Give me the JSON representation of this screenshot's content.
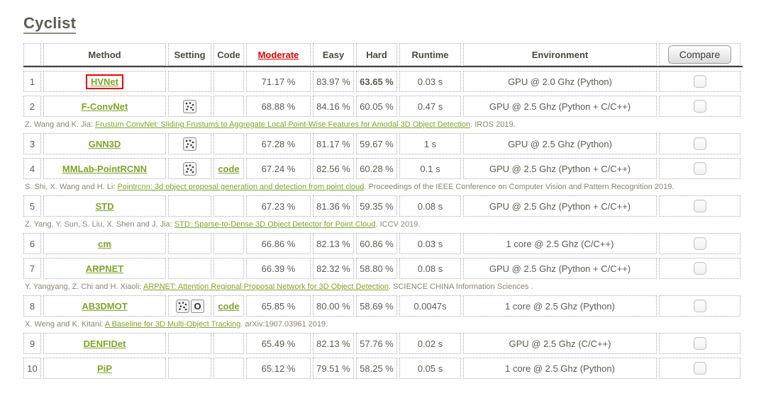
{
  "page": {
    "title": "Cyclist"
  },
  "colors": {
    "link_green": "#82a32d",
    "moderate_red": "#e10000",
    "highlight_box_red": "#f00000"
  },
  "table": {
    "headers": {
      "rank": "",
      "method": "Method",
      "setting": "Setting",
      "code": "Code",
      "moderate": "Moderate",
      "easy": "Easy",
      "hard": "Hard",
      "runtime": "Runtime",
      "environment": "Environment"
    },
    "compare_button": "Compare",
    "setting_icon_names": [
      "laser-points-icon",
      "letter-o-icon"
    ],
    "rows": [
      {
        "rank": "1",
        "method": "HVNet",
        "highlighted": true,
        "setting_icons": [],
        "code": "",
        "moderate": "71.17 %",
        "easy": "83.97 %",
        "hard": "63.65 %",
        "hard_bold": true,
        "runtime": "0.03 s",
        "environment": "GPU @ 2.0 Ghz (Python)",
        "citation": null
      },
      {
        "rank": "2",
        "method": "F-ConvNet",
        "highlighted": false,
        "setting_icons": [
          "points"
        ],
        "code": "",
        "moderate": "68.88 %",
        "easy": "84.16 %",
        "hard": "60.05 %",
        "hard_bold": false,
        "runtime": "0.47 s",
        "environment": "GPU @ 2.5 Ghz (Python + C/C++)",
        "citation": {
          "prefix": "Z. Wang and K. Jia: ",
          "link": "Frustum ConvNet: Sliding Frustums to Aggregate Local Point-Wise Features for Amodal 3D Object Detection",
          "suffix": ". IROS 2019."
        }
      },
      {
        "rank": "3",
        "method": "GNN3D",
        "highlighted": false,
        "setting_icons": [
          "points"
        ],
        "code": "",
        "moderate": "67.28 %",
        "easy": "81.17 %",
        "hard": "59.67 %",
        "hard_bold": false,
        "runtime": "1 s",
        "environment": "GPU @ 2.5 Ghz (Python)",
        "citation": null
      },
      {
        "rank": "4",
        "method": "MMLab-PointRCNN",
        "highlighted": false,
        "setting_icons": [
          "points"
        ],
        "code": "code",
        "moderate": "67.24 %",
        "easy": "82.56 %",
        "hard": "60.28 %",
        "hard_bold": false,
        "runtime": "0.1 s",
        "environment": "GPU @ 2.5 Ghz (Python + C/C++)",
        "citation": {
          "prefix": "S. Shi, X. Wang and H. Li: ",
          "link": "Pointrcnn: 3d object proposal generation and detection from point cloud",
          "suffix": ". Proceedings of the IEEE Conference on Computer Vision and Pattern Recognition 2019."
        }
      },
      {
        "rank": "5",
        "method": "STD",
        "highlighted": false,
        "setting_icons": [],
        "code": "",
        "moderate": "67.23 %",
        "easy": "81.36 %",
        "hard": "59.35 %",
        "hard_bold": false,
        "runtime": "0.08 s",
        "environment": "GPU @ 2.5 Ghz (Python + C/C++)",
        "citation": {
          "prefix": "Z. Yang, Y. Sun, S. Liu, X. Shen and J. Jia: ",
          "link": "STD: Sparse-to-Dense 3D Object Detector for Point Cloud",
          "suffix": ". ICCV 2019."
        }
      },
      {
        "rank": "6",
        "method": "cm",
        "highlighted": false,
        "setting_icons": [],
        "code": "",
        "moderate": "66.86 %",
        "easy": "82.13 %",
        "hard": "60.86 %",
        "hard_bold": false,
        "runtime": "0.03 s",
        "environment": "1 core @ 2.5 Ghz (C/C++)",
        "citation": null
      },
      {
        "rank": "7",
        "method": "ARPNET",
        "highlighted": false,
        "setting_icons": [],
        "code": "",
        "moderate": "66.39 %",
        "easy": "82.32 %",
        "hard": "58.80 %",
        "hard_bold": false,
        "runtime": "0.08 s",
        "environment": "GPU @ 2.5 Ghz (Python + C/C++)",
        "citation": {
          "prefix": "Y. Yangyang, Z. Chi and H. Xiaoli: ",
          "link": "ARPNET: Attention Regional Proposal Network for 3D Object Detection",
          "suffix": ". SCIENCE CHINA Information Sciences ."
        }
      },
      {
        "rank": "8",
        "method": "AB3DMOT",
        "highlighted": false,
        "setting_icons": [
          "points",
          "circle-o"
        ],
        "code": "code",
        "moderate": "65.85 %",
        "easy": "80.00 %",
        "hard": "58.69 %",
        "hard_bold": false,
        "runtime": "0.0047s",
        "environment": "1 core @ 2.5 Ghz (Python)",
        "citation": {
          "prefix": "X. Weng and K. Kitani: ",
          "link": "A Baseline for 3D Multi-Object Tracking",
          "suffix": ". arXiv:1907.03961 2019."
        }
      },
      {
        "rank": "9",
        "method": "DENFIDet",
        "highlighted": false,
        "setting_icons": [],
        "code": "",
        "moderate": "65.49 %",
        "easy": "82.13 %",
        "hard": "57.76 %",
        "hard_bold": false,
        "runtime": "0.02 s",
        "environment": "GPU @ 2.5 Ghz (C/C++)",
        "citation": null
      },
      {
        "rank": "10",
        "method": "PiP",
        "highlighted": false,
        "setting_icons": [],
        "code": "",
        "moderate": "65.12 %",
        "easy": "79.51 %",
        "hard": "58.25 %",
        "hard_bold": false,
        "runtime": "0.05 s",
        "environment": "1 core @ 2.5 Ghz (Python)",
        "citation": null
      }
    ]
  }
}
